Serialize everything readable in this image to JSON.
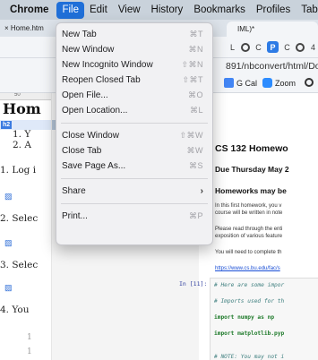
{
  "menubar": {
    "app": "Chrome",
    "items": [
      "File",
      "Edit",
      "View",
      "History",
      "Bookmarks",
      "Profiles",
      "Tab"
    ]
  },
  "tabs": {
    "left": "Home.htm",
    "right": "IML)*"
  },
  "toolbar": {
    "icons": [
      "L",
      "C",
      "P",
      "C",
      "4"
    ]
  },
  "address": {
    "url": "891/nbconvert/html/Doc"
  },
  "bookmarks": {
    "items": [
      "G Cal",
      "Zoom"
    ]
  },
  "left_pane": {
    "ruler_mark": "50",
    "heading": "Hom",
    "h2_badge": "h2",
    "list_items": [
      "1. Y",
      "2. A"
    ],
    "sections": [
      "1. Log i",
      "2. Selec",
      "3. Selec",
      "4. You"
    ],
    "gutter_numbers": [
      "1",
      "1",
      "1"
    ]
  },
  "middle_pane": {
    "tab_label": "H"
  },
  "notebook": {
    "title": "CS 132 Homewo",
    "due": "Due Thursday May 2",
    "homeworks": "Homeworks may be",
    "para1_line1": "In this first homework, you v",
    "para1_line2": "course will be written in note",
    "para2_line1": "Please read through the enti",
    "para2_line2": "exposition of various feature",
    "para3": "You will need to complete th",
    "link": "https://www.cs.bu.edu/fac/s",
    "in_label": "In [11]:",
    "code_lines": [
      "# Here are some impor",
      "# Imports used for th",
      "import numpy as np",
      "import matplotlib.pyp",
      "# NOTE: You may not i"
    ]
  },
  "file_menu": {
    "items": [
      {
        "label": "New Tab",
        "shortcut": "⌘T",
        "disabled": false
      },
      {
        "label": "New Window",
        "shortcut": "⌘N",
        "disabled": false
      },
      {
        "label": "New Incognito Window",
        "shortcut": "⇧⌘N",
        "disabled": false
      },
      {
        "label": "Reopen Closed Tab",
        "shortcut": "⇧⌘T",
        "disabled": false
      },
      {
        "label": "Open File...",
        "shortcut": "⌘O",
        "disabled": false
      },
      {
        "label": "Open Location...",
        "shortcut": "⌘L",
        "disabled": false
      },
      {
        "label": "Close Window",
        "shortcut": "⇧⌘W",
        "disabled": false
      },
      {
        "label": "Close Tab",
        "shortcut": "⌘W",
        "disabled": false
      },
      {
        "label": "Save Page As...",
        "shortcut": "⌘S",
        "disabled": false
      },
      {
        "label": "Share",
        "shortcut": "›",
        "disabled": false
      },
      {
        "label": "Print...",
        "shortcut": "⌘P",
        "disabled": false
      }
    ]
  },
  "colors": {
    "menubar_bg": "#c9d2db",
    "menu_active": "#1f6fd8",
    "link": "#1a4fd6",
    "code_keyword": "#1e7a2a",
    "code_comment": "#408080"
  }
}
